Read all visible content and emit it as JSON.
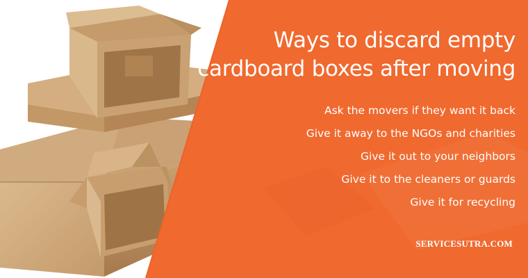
{
  "headline": {
    "line1": "Ways to discard empty",
    "line2": "cardboard boxes after moving"
  },
  "tips": [
    "Ask the movers if they want it back",
    "Give it away to the NGOs and charities",
    "Give it out to your neighbors",
    "Give it to the cleaners or guards",
    "Give it for recycling"
  ],
  "brand": "SERVICESUTRA.COM",
  "colors": {
    "panel_orange": "#f0692f",
    "cardboard": "#d2ab7c",
    "cardboard_dark": "#b98c5c",
    "text": "#ffffff"
  }
}
